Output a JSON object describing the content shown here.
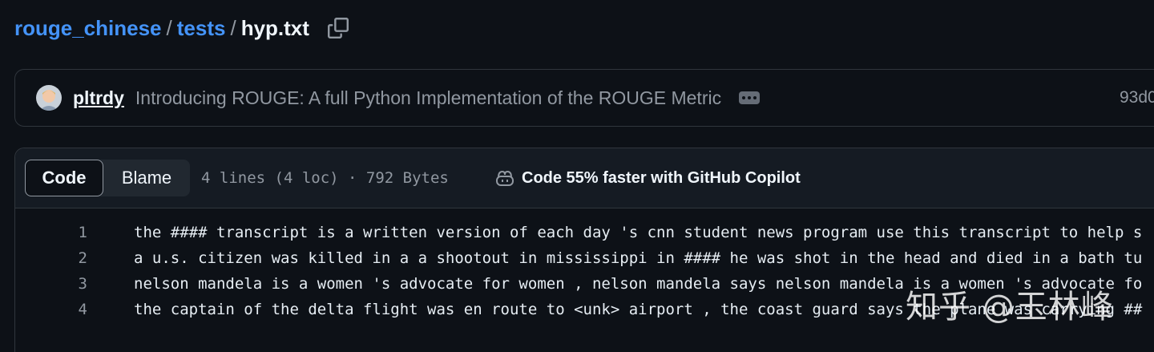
{
  "breadcrumb": {
    "repo": "rouge_chinese",
    "separator": "/",
    "folder": "tests",
    "file": "hyp.txt",
    "copy_icon": "copy-icon"
  },
  "commit": {
    "author": "pltrdy",
    "message": "Introducing ROUGE: A full Python Implementation of the ROUGE Metric",
    "sha": "93d0",
    "more_icon": "ellipsis-icon"
  },
  "file_header": {
    "code_tab": "Code",
    "blame_tab": "Blame",
    "meta": "4 lines (4 loc) · 792 Bytes",
    "copilot_text": "Code 55% faster with GitHub Copilot",
    "copilot_icon": "copilot-icon"
  },
  "code": {
    "lines": [
      {
        "num": "1",
        "text": "the #### transcript is a written version of each day 's cnn student news program use this transcript to help s"
      },
      {
        "num": "2",
        "text": "a u.s. citizen was killed in a a shootout in mississippi in #### he was shot in the head and died in a bath tu"
      },
      {
        "num": "3",
        "text": "nelson mandela is a women 's advocate for women , nelson mandela says nelson mandela is a women 's advocate fo"
      },
      {
        "num": "4",
        "text": "the captain of the delta flight was en route to <unk> airport , the coast guard says the plane was carrying ##"
      }
    ]
  },
  "watermark": "知乎 @玉林峰",
  "colors": {
    "background": "#0d1117",
    "link": "#4493f8",
    "border": "#30363d",
    "muted": "#9198a1"
  }
}
